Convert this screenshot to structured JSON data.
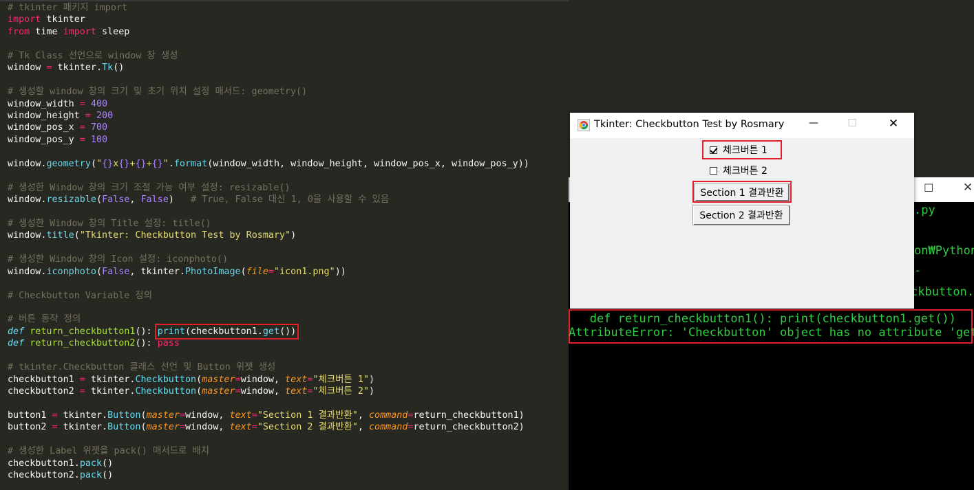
{
  "editor": {
    "lines": {
      "l1": "# tkinter 패키지 import",
      "l2_kw": "import",
      "l2_rest": " tkinter",
      "l3_kw1": "from",
      "l3_mid": " time ",
      "l3_kw2": "import",
      "l3_rest": " sleep",
      "l5": "# Tk Class 선언으로 window 창 생성",
      "l6_a": "window ",
      "l6_op": "=",
      "l6_b": " tkinter.",
      "l6_f": "Tk",
      "l6_c": "()",
      "l8": "# 생성할 window 창의 크기 및 초기 위치 설정 매서드: geometry()",
      "l9_a": "window_width ",
      "l9_op": "=",
      "l9_n": " 400",
      "l10_a": "window_height ",
      "l10_op": "=",
      "l10_n": " 200",
      "l11_a": "window_pos_x ",
      "l11_op": "=",
      "l11_n": " 700",
      "l12_a": "window_pos_y ",
      "l12_op": "=",
      "l12_n": " 100",
      "l14_a": "window.",
      "l14_f": "geometry",
      "l14_b": "(",
      "l14_s1": "\"",
      "l14_p1": "{}",
      "l14_s2": "x",
      "l14_p2": "{}",
      "l14_s3": "+",
      "l14_p3": "{}",
      "l14_s4": "+",
      "l14_p4": "{}",
      "l14_s5": "\"",
      "l14_c": ".",
      "l14_f2": "format",
      "l14_d": "(window_width, window_height, window_pos_x, window_pos_y))",
      "l16": "# 생성한 Window 창의 크기 조절 가능 여부 설정: resizable()",
      "l17_a": "window.",
      "l17_f": "resizable",
      "l17_b": "(",
      "l17_n1": "False",
      "l17_c": ", ",
      "l17_n2": "False",
      "l17_d": ")   ",
      "l17_cm": "# True, False 대신 1, 0을 사용할 수 있음",
      "l19": "# 생성한 Window 창의 Title 설정: title()",
      "l20_a": "window.",
      "l20_f": "title",
      "l20_b": "(",
      "l20_s": "\"Tkinter: Checkbutton Test by Rosmary\"",
      "l20_c": ")",
      "l22": "# 생성한 Window 창의 Icon 설정: iconphoto()",
      "l23_a": "window.",
      "l23_f": "iconphoto",
      "l23_b": "(",
      "l23_n": "False",
      "l23_c": ", tkinter.",
      "l23_f2": "PhotoImage",
      "l23_d": "(",
      "l23_arg": "file",
      "l23_op": "=",
      "l23_s": "\"icon1.png\"",
      "l23_e": "))",
      "l25": "# Checkbutton Variable 정의",
      "l27": "# 버튼 동작 정의",
      "l28_kw": "def",
      "l28_fn": " return_checkbutton1",
      "l28_b": "(): ",
      "l28_f": "print",
      "l28_c": "(checkbutton1.",
      "l28_f2": "get",
      "l28_d": "())",
      "l29_kw": "def",
      "l29_fn": " return_checkbutton2",
      "l29_b": "(): ",
      "l29_kw2": "pass",
      "l31": "# tkinter.Checkbutton 클래스 선언 및 Button 위젯 생성",
      "l32_a": "checkbutton1 ",
      "l32_op": "=",
      "l32_b": " tkinter.",
      "l32_f": "Checkbutton",
      "l32_c": "(",
      "l32_arg1": "master",
      "l32_op2": "=",
      "l32_d": "window, ",
      "l32_arg2": "text",
      "l32_op3": "=",
      "l32_s": "\"체크버튼 1\"",
      "l32_e": ")",
      "l33_a": "checkbutton2 ",
      "l33_op": "=",
      "l33_b": " tkinter.",
      "l33_f": "Checkbutton",
      "l33_c": "(",
      "l33_arg1": "master",
      "l33_op2": "=",
      "l33_d": "window, ",
      "l33_arg2": "text",
      "l33_op3": "=",
      "l33_s": "\"체크버튼 2\"",
      "l33_e": ")",
      "l35_a": "button1 ",
      "l35_op": "=",
      "l35_b": " tkinter.",
      "l35_f": "Button",
      "l35_c": "(",
      "l35_arg1": "master",
      "l35_op2": "=",
      "l35_d": "window, ",
      "l35_arg2": "text",
      "l35_op3": "=",
      "l35_s": "\"Section 1 결과반환\"",
      "l35_e": ", ",
      "l35_arg3": "command",
      "l35_op4": "=",
      "l35_g": "return_checkbutton1)",
      "l36_a": "button2 ",
      "l36_op": "=",
      "l36_b": " tkinter.",
      "l36_f": "Button",
      "l36_c": "(",
      "l36_arg1": "master",
      "l36_op2": "=",
      "l36_d": "window, ",
      "l36_arg2": "text",
      "l36_op3": "=",
      "l36_s": "\"Section 2 결과반환\"",
      "l36_e": ", ",
      "l36_arg3": "command",
      "l36_op4": "=",
      "l36_g": "return_checkbutton2)",
      "l38": "# 생성한 Label 위젯을 pack() 매서드로 배치",
      "l39_a": "checkbutton1.",
      "l39_f": "pack",
      "l39_b": "()",
      "l40_a": "checkbutton2.",
      "l40_f": "pack",
      "l40_b": "()"
    }
  },
  "tk_window": {
    "title": "Tkinter: Checkbutton Test by Rosmary",
    "minimize": "—",
    "maximize": "☐",
    "close": "✕",
    "checkbutton1": {
      "label": "체크버튼 1",
      "checked": true
    },
    "checkbutton2": {
      "label": "체크버튼 2",
      "checked": false
    },
    "button1": "Section 1 결과반환",
    "button2": "Section 2 결과반환"
  },
  "terminal": {
    "maximize": "☐",
    "close": "✕",
    "frag1": ".py",
    "frag2": "on₩Python",
    "frag3": "-",
    "frag4": "ckbutton.",
    "error_line1": "   def return_checkbutton1(): print(checkbutton1.get())",
    "error_line2": "AttributeError: 'Checkbutton' object has no attribute 'get'"
  },
  "colors": {
    "editor_bg": "#272822",
    "highlight_red": "#e0202a",
    "terminal_text": "#2ecc40"
  }
}
